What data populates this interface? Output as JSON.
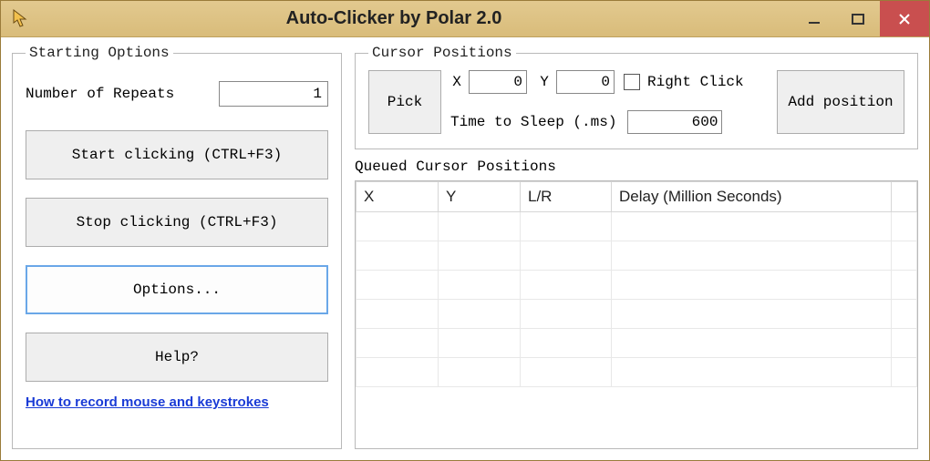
{
  "window": {
    "title": "Auto-Clicker by Polar 2.0"
  },
  "starting": {
    "legend": "Starting Options",
    "repeats_label": "Number of Repeats",
    "repeats_value": "1",
    "start_btn": "Start clicking (CTRL+F3)",
    "stop_btn": "Stop clicking (CTRL+F3)",
    "options_btn": "Options...",
    "help_btn": "Help?",
    "link": "How to record mouse and keystrokes"
  },
  "cursor": {
    "legend": "Cursor Positions",
    "pick_btn": "Pick",
    "x_label": "X",
    "x_value": "0",
    "y_label": "Y",
    "y_value": "0",
    "right_click_label": "Right Click",
    "right_click_checked": false,
    "sleep_label": "Time to Sleep (.ms)",
    "sleep_value": "600",
    "add_btn": "Add position"
  },
  "queued": {
    "label": "Queued Cursor Positions",
    "columns": {
      "x": "X",
      "y": "Y",
      "lr": "L/R",
      "delay": "Delay (Million Seconds)"
    },
    "rows": []
  }
}
